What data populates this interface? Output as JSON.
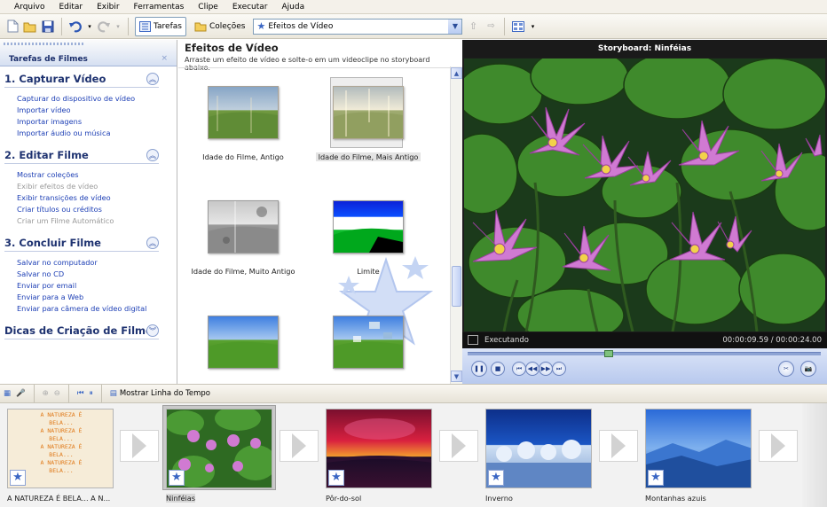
{
  "menu": [
    "Arquivo",
    "Editar",
    "Exibir",
    "Ferramentas",
    "Clipe",
    "Executar",
    "Ajuda"
  ],
  "toolbar": {
    "tasks_label": "Tarefas",
    "collections_label": "Coleções",
    "effect_combo_value": "Efeitos de Vídeo"
  },
  "tasks_pane": {
    "title": "Tarefas de Filmes",
    "close": "×",
    "sections": [
      {
        "title": "1. Capturar Vídeo",
        "items": [
          {
            "label": "Capturar do dispositivo de vídeo",
            "enabled": true
          },
          {
            "label": "Importar vídeo",
            "enabled": true
          },
          {
            "label": "Importar imagens",
            "enabled": true
          },
          {
            "label": "Importar áudio ou música",
            "enabled": true
          }
        ]
      },
      {
        "title": "2. Editar Filme",
        "items": [
          {
            "label": "Mostrar coleções",
            "enabled": true
          },
          {
            "label": "Exibir efeitos de vídeo",
            "enabled": false
          },
          {
            "label": "Exibir transições de vídeo",
            "enabled": true
          },
          {
            "label": "Criar títulos ou créditos",
            "enabled": true
          },
          {
            "label": "Criar um Filme Automático",
            "enabled": false
          }
        ]
      },
      {
        "title": "3. Concluir Filme",
        "items": [
          {
            "label": "Salvar no computador",
            "enabled": true
          },
          {
            "label": "Salvar no CD",
            "enabled": true
          },
          {
            "label": "Enviar por email",
            "enabled": true
          },
          {
            "label": "Enviar para a Web",
            "enabled": true
          },
          {
            "label": "Enviar para câmera de vídeo digital",
            "enabled": true
          }
        ]
      },
      {
        "title": "Dicas de Criação de Filme",
        "items": []
      }
    ]
  },
  "effects_pane": {
    "title": "Efeitos de Vídeo",
    "subtitle": "Arraste um efeito de vídeo e solte-o em um videoclipe no storyboard abaixo.",
    "effects": [
      {
        "label": "Idade do Filme, Antigo",
        "selected": false
      },
      {
        "label": "Idade do Filme, Mais Antigo",
        "selected": true
      },
      {
        "label": "Idade do Filme, Muito Antigo",
        "selected": false
      },
      {
        "label": "Limite",
        "selected": false
      },
      {
        "label": "",
        "selected": false
      },
      {
        "label": "",
        "selected": false
      }
    ]
  },
  "monitor": {
    "title": "Storyboard: Ninféias",
    "status": "Executando",
    "time": "00:00:09.59 / 00:00:24.00",
    "progress": 0.4
  },
  "timeline_toolbar": {
    "show_timeline_label": "Mostrar Linha do Tempo"
  },
  "storyboard": {
    "clips": [
      {
        "label": "A NATUREZA É BELA... A N...",
        "selected": false,
        "title_text": [
          "A NATUREZA É",
          "BELA...",
          "A NATUREZA É",
          "BELA...",
          "A NATUREZA É",
          "BELA...",
          "A NATUREZA É",
          "BELA..."
        ]
      },
      {
        "label": "Ninféias",
        "selected": true
      },
      {
        "label": "Pôr-do-sol",
        "selected": false
      },
      {
        "label": "Inverno",
        "selected": false
      },
      {
        "label": "Montanhas azuis",
        "selected": false
      }
    ]
  },
  "colors": {
    "link": "#1d3fb5",
    "section_title": "#1e3270",
    "monitor_bg": "#1c1c1c"
  }
}
